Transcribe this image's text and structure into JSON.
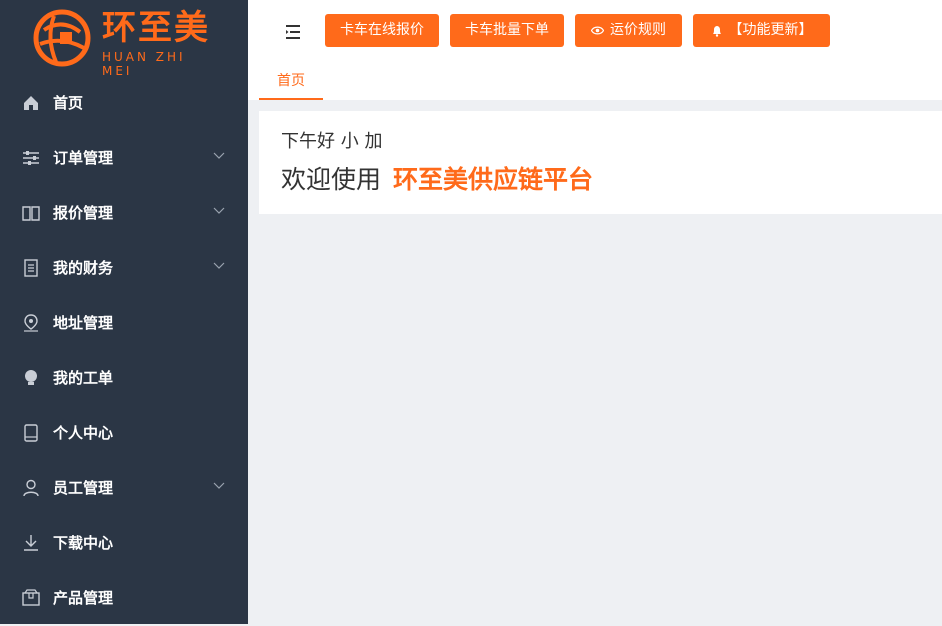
{
  "logo": {
    "title": "环至美",
    "subtitle": "HUAN ZHI MEI"
  },
  "sidebar": {
    "items": [
      {
        "label": "首页",
        "icon": "home-icon",
        "expandable": false
      },
      {
        "label": "订单管理",
        "icon": "sliders-icon",
        "expandable": true
      },
      {
        "label": "报价管理",
        "icon": "book-icon",
        "expandable": true
      },
      {
        "label": "我的财务",
        "icon": "document-icon",
        "expandable": true
      },
      {
        "label": "地址管理",
        "icon": "map-pin-icon",
        "expandable": false
      },
      {
        "label": "我的工单",
        "icon": "lightbulb-icon",
        "expandable": false
      },
      {
        "label": "个人中心",
        "icon": "tablet-icon",
        "expandable": false
      },
      {
        "label": "员工管理",
        "icon": "user-icon",
        "expandable": true
      },
      {
        "label": "下载中心",
        "icon": "download-icon",
        "expandable": false
      },
      {
        "label": "产品管理",
        "icon": "package-icon",
        "expandable": false
      }
    ]
  },
  "toolbar": {
    "btn_quote": "卡车在线报价",
    "btn_batch": "卡车批量下单",
    "btn_rules": "运价规则",
    "btn_update": "【功能更新】"
  },
  "tabs": {
    "home": "首页"
  },
  "welcome": {
    "greeting": "下午好 小 加",
    "prefix": "欢迎使用",
    "brand": "环至美供应链平台"
  },
  "colors": {
    "accent": "#ff6a1a",
    "sidebar_bg": "#2b3645",
    "content_bg": "#eef0f3"
  }
}
